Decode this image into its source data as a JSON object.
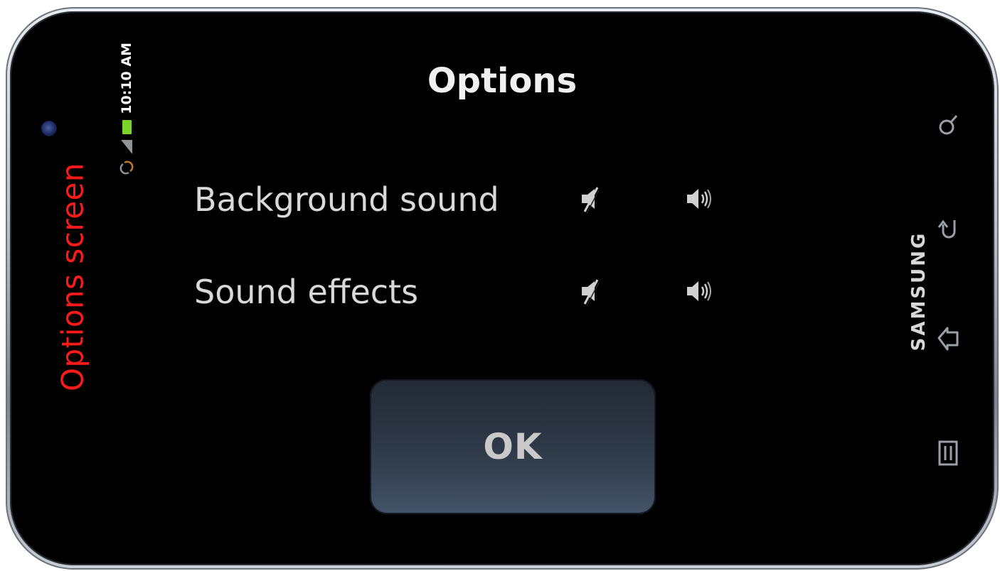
{
  "side_annotation": "Options screen",
  "status_bar": {
    "time": "10:10 AM",
    "icons": [
      "sync-icon",
      "signal-icon",
      "battery-icon"
    ],
    "battery_color": "#7cd32a"
  },
  "dialog": {
    "title": "Options",
    "rows": [
      {
        "label": "Background sound",
        "icons": [
          "mute-icon",
          "speaker-icon"
        ]
      },
      {
        "label": "Sound effects",
        "icons": [
          "mute-icon",
          "speaker-icon"
        ]
      }
    ],
    "ok_label": "OK"
  },
  "device": {
    "brand": "SAMSUNG",
    "hardware_keys": [
      "search-icon",
      "back-icon",
      "home-icon",
      "menu-icon"
    ]
  },
  "colors": {
    "annotation": "#ff1a1a",
    "screen_bg": "#000000",
    "button_bg": "#2b3543"
  }
}
